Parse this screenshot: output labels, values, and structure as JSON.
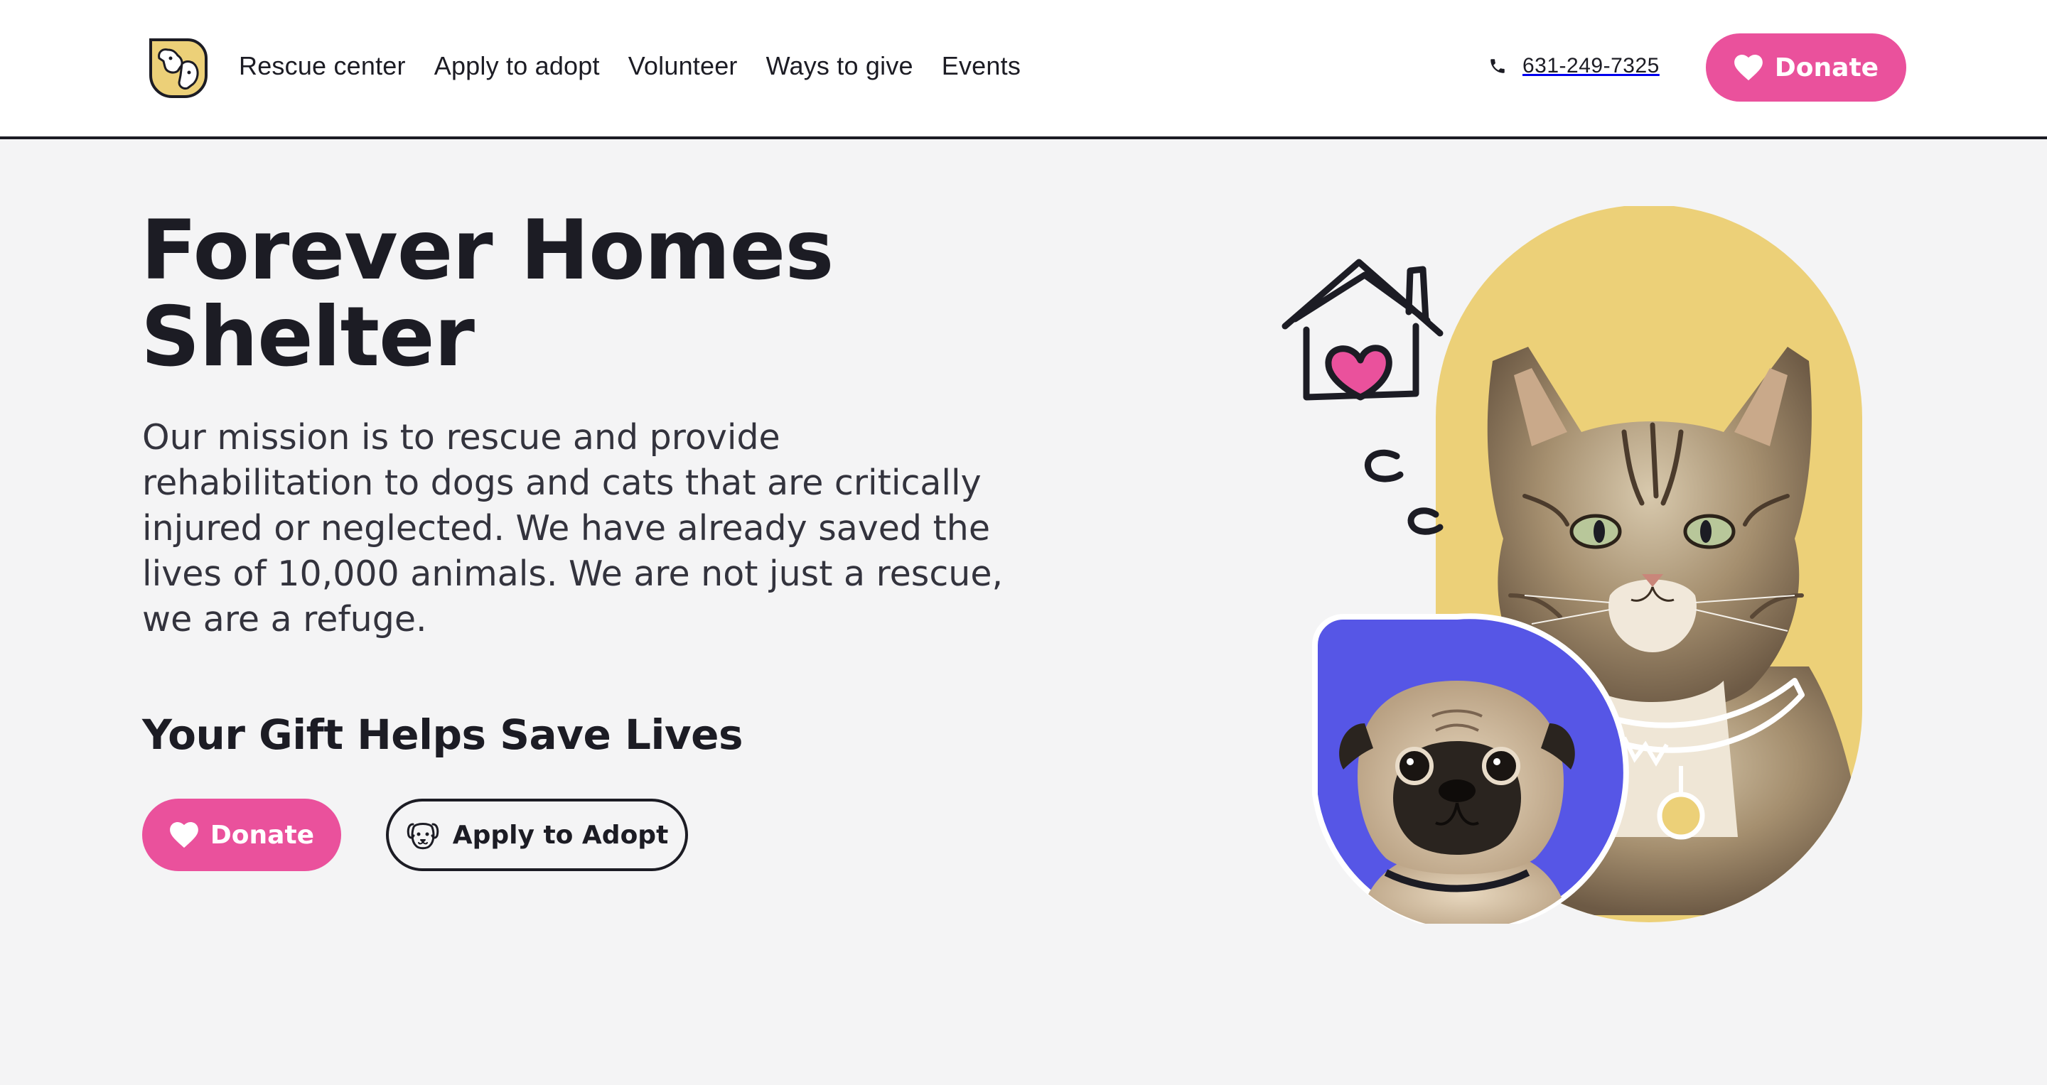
{
  "header": {
    "logo_name": "rescue-logo",
    "nav": [
      {
        "label": "Rescue center"
      },
      {
        "label": "Apply to adopt"
      },
      {
        "label": "Volunteer"
      },
      {
        "label": "Ways to give"
      },
      {
        "label": "Events"
      }
    ],
    "phone": "631-249-7325",
    "donate_label": "Donate"
  },
  "hero": {
    "title_line1": "Forever Homes",
    "title_line2": "Shelter",
    "mission": "Our mission is to rescue and provide rehabilitation to dogs and cats that are critically injured or neglected. We have already saved the lives of 10,000 animals. We are not just a rescue, we are a refuge.",
    "gift_heading": "Your Gift Helps Save Lives",
    "donate_label": "Donate",
    "adopt_label": "Apply to Adopt"
  },
  "colors": {
    "accent": "#ea519c",
    "dark": "#1c1c24",
    "yellow": "#ecd078",
    "blue": "#5656e6",
    "background": "#f4f4f5"
  },
  "icons": [
    "phone-icon",
    "heart-icon",
    "dog-face-icon",
    "house-heart-icon"
  ]
}
